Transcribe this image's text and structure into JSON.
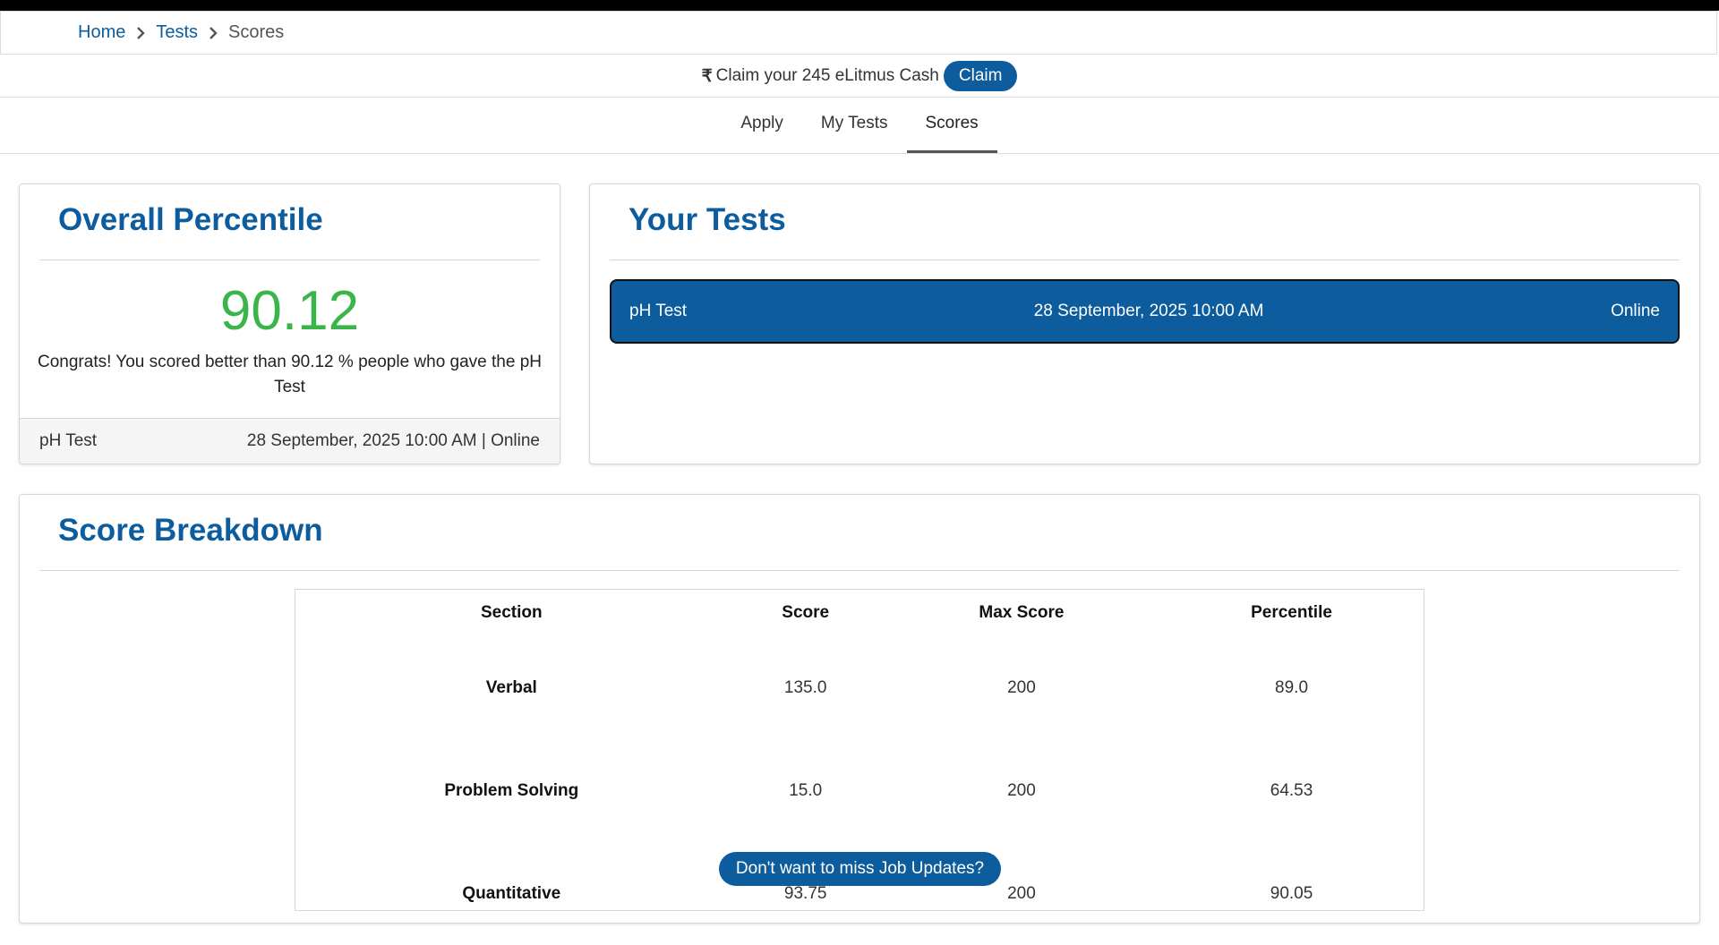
{
  "breadcrumb": {
    "home": "Home",
    "tests": "Tests",
    "current": "Scores"
  },
  "claim_bar": {
    "currency_symbol": "₹",
    "text": "Claim your 245 eLitmus Cash",
    "button": "Claim"
  },
  "tabs": [
    {
      "label": "Apply",
      "active": false
    },
    {
      "label": "My Tests",
      "active": false
    },
    {
      "label": "Scores",
      "active": true
    }
  ],
  "overall": {
    "title": "Overall Percentile",
    "value": "90.12",
    "message": "Congrats! You scored better than 90.12 % people who gave the pH Test",
    "footer_test": "pH Test",
    "footer_meta": "28 September, 2025 10:00 AM | Online"
  },
  "your_tests": {
    "title": "Your Tests",
    "items": [
      {
        "name": "pH Test",
        "date": "28 September, 2025 10:00 AM",
        "mode": "Online"
      }
    ]
  },
  "score_breakdown": {
    "title": "Score Breakdown",
    "headers": [
      "Section",
      "Score",
      "Max Score",
      "Percentile"
    ],
    "rows": [
      [
        "Verbal",
        "135.0",
        "200",
        "89.0"
      ],
      [
        "Problem Solving",
        "15.0",
        "200",
        "64.53"
      ],
      [
        "Quantitative",
        "93.75",
        "200",
        "90.05"
      ]
    ]
  },
  "job_updates_button": "Don't want to miss Job Updates?",
  "colors": {
    "brand_blue": "#0d5c9e",
    "percentile_green": "#3bb54a"
  }
}
